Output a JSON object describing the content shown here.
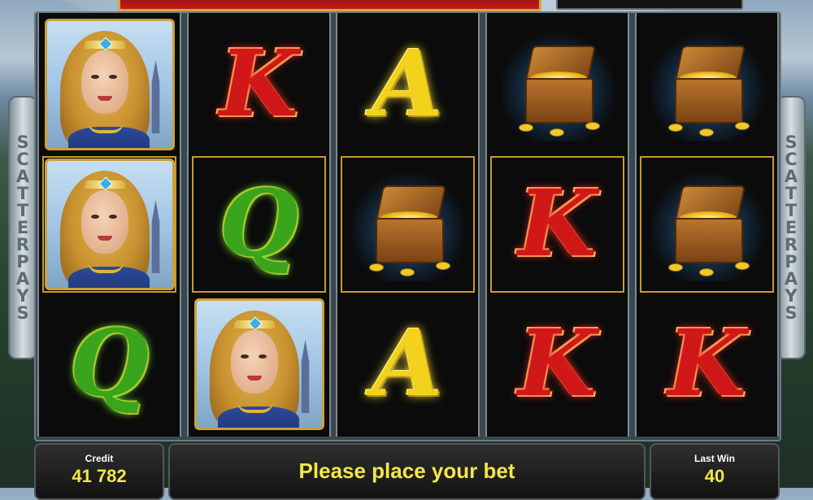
{
  "side_panels": {
    "left_text": "SCATTER PAYS",
    "right_text": "SCATTER PAYS"
  },
  "reels": [
    [
      "princess",
      "princess",
      "Q"
    ],
    [
      "K",
      "Q",
      "princess"
    ],
    [
      "A",
      "treasure-chest",
      "A"
    ],
    [
      "treasure-chest",
      "K",
      "K"
    ],
    [
      "treasure-chest",
      "treasure-chest",
      "K"
    ]
  ],
  "highlighted_row": 1,
  "symbol_colors": {
    "K": "#d01818",
    "A": "#f2d21c",
    "Q": "#3aa41c"
  },
  "status": {
    "credit_label": "Credit",
    "credit_value": "41 782",
    "message": "Please place your bet",
    "last_win_label": "Last Win",
    "last_win_value": "40"
  }
}
